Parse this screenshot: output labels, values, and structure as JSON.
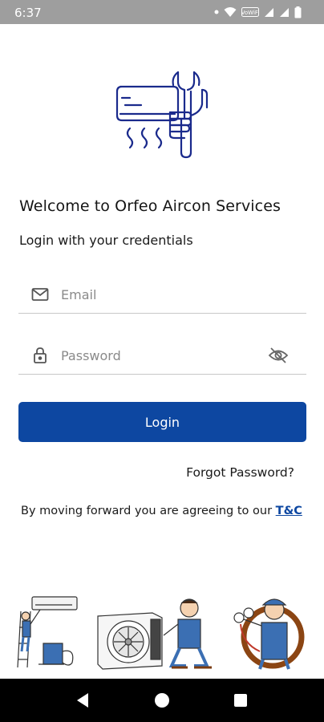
{
  "status_bar": {
    "time": "6:37",
    "icons": [
      "wifi-icon",
      "signal-icon",
      "battery-icon"
    ]
  },
  "app": {
    "logo": "aircon-wrench-logo",
    "welcome": "Welcome to Orfeo Aircon Services",
    "subtitle": "Login with your credentials"
  },
  "form": {
    "email_placeholder": "Email",
    "email_value": "",
    "password_placeholder": "Password",
    "password_value": "",
    "login_label": "Login",
    "forgot_label": "Forgot Password?"
  },
  "terms": {
    "prefix": "By moving forward you are agreeing to our ",
    "link": "T&C"
  },
  "colors": {
    "primary": "#0d47a1",
    "logo_stroke": "#1a2a8c",
    "status_bar": "#9e9e9e",
    "nav_bar": "#000000"
  },
  "illustrations": [
    "technician-ladder-aircon",
    "technician-outdoor-unit",
    "technician-gauges"
  ],
  "nav": [
    "back-button",
    "home-button",
    "recents-button"
  ]
}
